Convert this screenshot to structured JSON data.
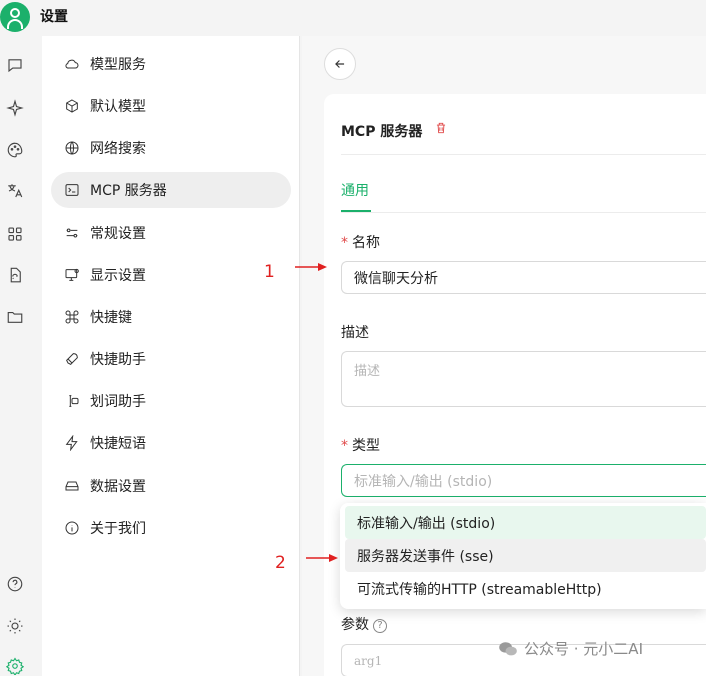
{
  "app": {
    "title": "设置"
  },
  "rail": {
    "icons": [
      "chat-icon",
      "sparkle-icon",
      "palette-icon",
      "translate-icon",
      "apps-grid-icon",
      "doc-sync-icon",
      "folder-icon",
      "help-icon",
      "theme-icon",
      "settings-icon"
    ]
  },
  "menu": {
    "items": [
      {
        "label": "模型服务",
        "icon": "cloud-icon"
      },
      {
        "label": "默认模型",
        "icon": "cube-icon"
      },
      {
        "label": "网络搜索",
        "icon": "globe-icon"
      },
      {
        "label": "MCP 服务器",
        "icon": "terminal-icon"
      },
      {
        "label": "常规设置",
        "icon": "sliders-icon"
      },
      {
        "label": "显示设置",
        "icon": "monitor-icon"
      },
      {
        "label": "快捷键",
        "icon": "command-icon"
      },
      {
        "label": "快捷助手",
        "icon": "rocket-icon"
      },
      {
        "label": "划词助手",
        "icon": "text-cursor-icon"
      },
      {
        "label": "快捷短语",
        "icon": "zap-icon"
      },
      {
        "label": "数据设置",
        "icon": "drive-icon"
      },
      {
        "label": "关于我们",
        "icon": "info-icon"
      }
    ],
    "selected": "MCP 服务器"
  },
  "form": {
    "title": "MCP 服务器",
    "tab": "通用",
    "name_label": "名称",
    "name_value": "微信聊天分析",
    "desc_label": "描述",
    "desc_placeholder": "描述",
    "type_label": "类型",
    "type_value": "标准输入/输出 (stdio)",
    "type_options": [
      "标准输入/输出 (stdio)",
      "服务器发送事件 (sse)",
      "可流式传输的HTTP (streamableHttp)"
    ],
    "params_label": "参数",
    "params_placeholder": "arg1",
    "required_mark": "*",
    "help_glyph": "?"
  },
  "annotations": {
    "one": "1",
    "two": "2"
  },
  "watermark": "公众号 · 元小二AI",
  "colors": {
    "accent": "#1bb06b",
    "danger": "#e04848",
    "annotation": "#e02020"
  }
}
